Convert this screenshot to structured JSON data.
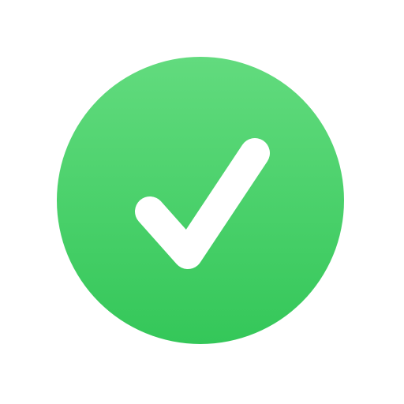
{
  "icon": {
    "name": "checkmark-circle-icon",
    "colors": {
      "background": "#ffffff",
      "circle_top": "#62DB7E",
      "circle_bottom": "#34C759",
      "check": "#ffffff"
    }
  }
}
